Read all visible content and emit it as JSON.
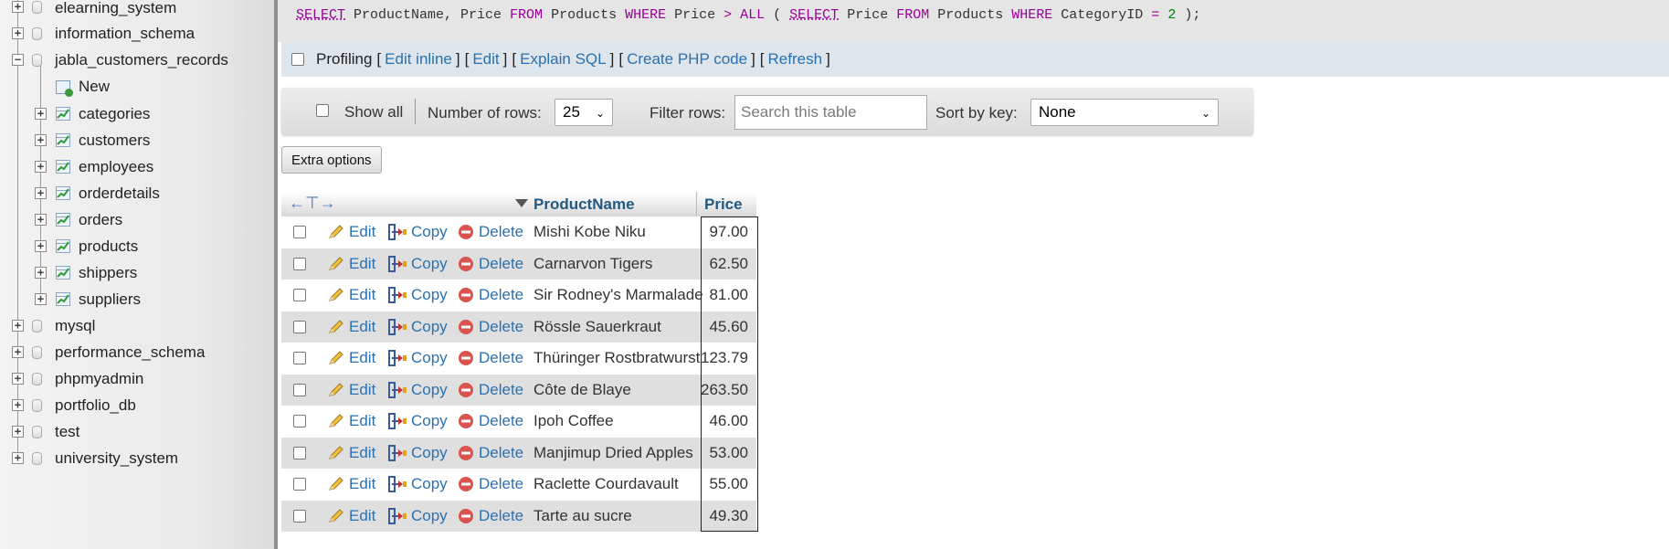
{
  "sidebar": {
    "top_databases": [
      {
        "label": "elearning_system"
      },
      {
        "label": "information_schema"
      },
      {
        "label": "jabla_customers_records"
      }
    ],
    "new_label": "New",
    "tables": [
      {
        "label": "categories"
      },
      {
        "label": "customers"
      },
      {
        "label": "employees"
      },
      {
        "label": "orderdetails"
      },
      {
        "label": "orders"
      },
      {
        "label": "products"
      },
      {
        "label": "shippers"
      },
      {
        "label": "suppliers"
      }
    ],
    "bottom_databases": [
      {
        "label": "mysql"
      },
      {
        "label": "performance_schema"
      },
      {
        "label": "phpmyadmin"
      },
      {
        "label": "portfolio_db"
      },
      {
        "label": "test"
      },
      {
        "label": "university_system"
      }
    ]
  },
  "sql": {
    "kw_select1": "SELECT",
    "part1": " ProductName, Price ",
    "kw_from1": "FROM",
    "part2": " Products ",
    "kw_where1": "WHERE",
    "part3": " Price ",
    "op_gt": ">",
    "part4": " ",
    "kw_all": "ALL",
    "part5": " ( ",
    "kw_select2": "SELECT",
    "part6": " Price ",
    "kw_from2": "FROM",
    "part7": " Products ",
    "kw_where2": "WHERE",
    "part8": " CategoryID ",
    "op_eq": "=",
    "part9": " ",
    "num_2": "2",
    "part10": " );"
  },
  "profiling": {
    "label": "Profiling",
    "open": "[",
    "close": "]",
    "links": [
      "Edit inline",
      "Edit",
      "Explain SQL",
      "Create PHP code",
      "Refresh"
    ]
  },
  "nav": {
    "show_all": "Show all",
    "rows_label": "Number of rows:",
    "rows_value": "25",
    "filter_label": "Filter rows:",
    "filter_placeholder": "Search this table",
    "sort_label": "Sort by key:",
    "sort_value": "None"
  },
  "extra_options": "Extra options",
  "table": {
    "col_name": "ProductName",
    "col_price": "Price",
    "edit_label": "Edit",
    "copy_label": "Copy",
    "delete_label": "Delete",
    "rows": [
      {
        "name": "Mishi Kobe Niku",
        "price": "97.00"
      },
      {
        "name": "Carnarvon Tigers",
        "price": "62.50"
      },
      {
        "name": "Sir Rodney's Marmalade",
        "price": "81.00"
      },
      {
        "name": "Rössle Sauerkraut",
        "price": "45.60"
      },
      {
        "name": "Thüringer Rostbratwurst",
        "price": "123.79"
      },
      {
        "name": "Côte de Blaye",
        "price": "263.50"
      },
      {
        "name": "Ipoh Coffee",
        "price": "46.00"
      },
      {
        "name": "Manjimup Dried Apples",
        "price": "53.00"
      },
      {
        "name": "Raclette Courdavault",
        "price": "55.00"
      },
      {
        "name": "Tarte au sucre",
        "price": "49.30"
      }
    ]
  }
}
